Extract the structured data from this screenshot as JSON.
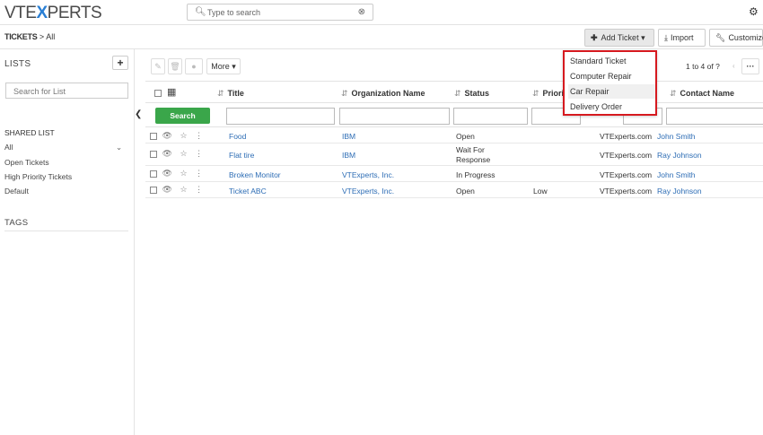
{
  "header": {
    "logo_left": "VTE",
    "logo_x": "X",
    "logo_right": "PERTS",
    "search_placeholder": "Type to search"
  },
  "breadcrumb": {
    "module": "TICKETS",
    "separator": ">",
    "current": "All"
  },
  "toolbar": {
    "add_ticket": "Add Ticket",
    "import": "Import",
    "customize": "Customize",
    "more": "More",
    "pagination": "1 to 4  of ?"
  },
  "add_ticket_menu": [
    "Standard Ticket",
    "Computer Repair",
    "Car Repair",
    "Delivery Order"
  ],
  "sidebar": {
    "lists_title": "LISTS",
    "search_placeholder": "Search for List",
    "shared_title": "SHARED LIST",
    "items": [
      "All",
      "Open Tickets",
      "High Priority Tickets",
      "Default"
    ],
    "tags_title": "TAGS"
  },
  "table": {
    "search_button": "Search",
    "columns": [
      "Title",
      "Organization Name",
      "Status",
      "Priorit",
      "Contact Name"
    ],
    "rows": [
      {
        "title": "Food",
        "org": "IBM",
        "status": "Open",
        "priority": "",
        "site": "VTExperts.com",
        "contact": "John Smith"
      },
      {
        "title": "Flat tire",
        "org": "IBM",
        "status": "Wait For Response",
        "status_l1": "Wait For",
        "status_l2": "Response",
        "priority": "",
        "site": "VTExperts.com",
        "contact": "Ray Johnson"
      },
      {
        "title": "Broken Monitor",
        "org": "VTExperts, Inc.",
        "status": "In Progress",
        "priority": "",
        "site": "VTExperts.com",
        "contact": "John Smith"
      },
      {
        "title": "Ticket ABC",
        "org": "VTExperts, Inc.",
        "status": "Open",
        "priority": "Low",
        "site": "VTExperts.com",
        "contact": "Ray Johnson"
      }
    ]
  },
  "colors": {
    "accent": "#2d6db5",
    "search_button": "#3aa64a",
    "highlight_border": "#d6191f"
  }
}
